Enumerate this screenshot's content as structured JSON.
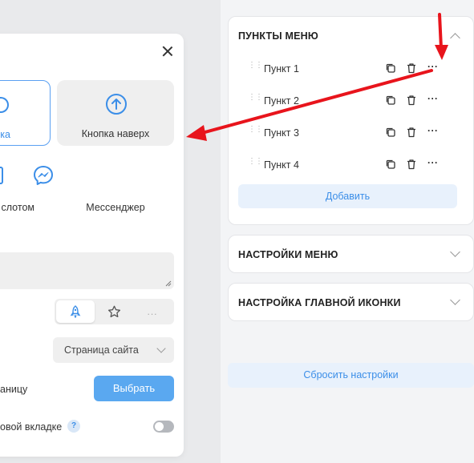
{
  "modal": {
    "tiles": [
      {
        "label": "ка",
        "icon": "chat-icon",
        "selected": true
      },
      {
        "label": "Кнопка наверх",
        "icon": "arrow-up-circle-icon",
        "selected": false
      },
      {
        "label": "слотом",
        "icon": "phone-icon",
        "selected": false
      },
      {
        "label": "Мессенджер",
        "icon": "messenger-icon",
        "selected": false
      }
    ],
    "icon_options": [
      {
        "icon": "rocket-icon",
        "active": true
      },
      {
        "icon": "star-icon",
        "active": false
      },
      {
        "icon": "more-icon",
        "label": "...",
        "active": false
      }
    ],
    "select_value": "Страница сайта",
    "page_label": "аницу",
    "choose_button": "Выбрать",
    "new_tab_label": "овой вкладке",
    "help_badge": "?",
    "new_tab_enabled": false
  },
  "menu_items_card": {
    "title": "ПУНКТЫ МЕНЮ",
    "expanded": true,
    "items": [
      {
        "label": "Пункт 1"
      },
      {
        "label": "Пункт 2"
      },
      {
        "label": "Пункт 3"
      },
      {
        "label": "Пункт 4"
      }
    ],
    "add_button": "Добавить"
  },
  "menu_settings_card": {
    "title": "НАСТРОЙКИ МЕНЮ",
    "expanded": false
  },
  "main_icon_card": {
    "title": "НАСТРОЙКА ГЛАВНОЙ ИКОНКИ",
    "expanded": false
  },
  "reset_button": "Сбросить настройки",
  "colors": {
    "accent": "#3b8ee8",
    "button": "#5aa8f0",
    "annotation": "#e8141c"
  }
}
